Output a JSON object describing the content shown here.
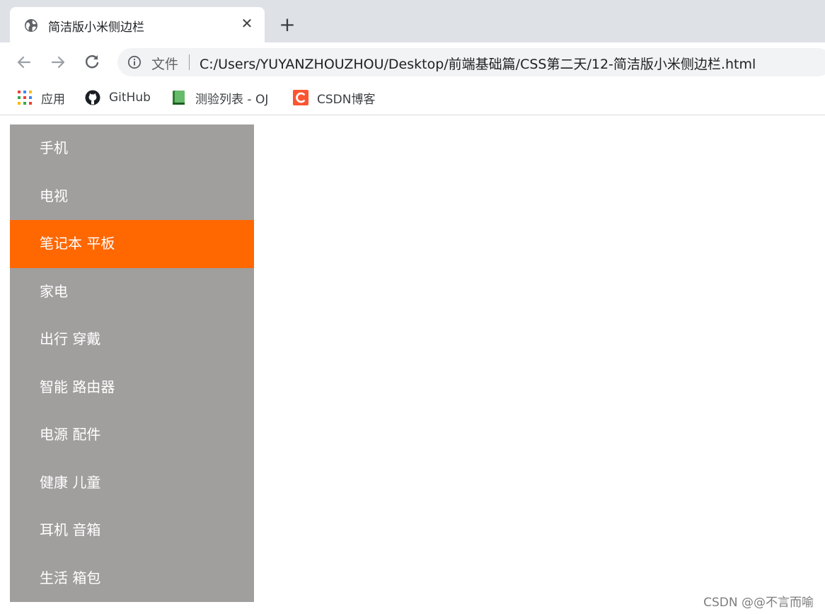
{
  "tab": {
    "title": "简洁版小米侧边栏",
    "close_glyph": "✕",
    "new_tab_glyph": "+"
  },
  "toolbar": {
    "scheme_label": "文件",
    "url": "C:/Users/YUYANZHOUZHOU/Desktop/前端基础篇/CSS第二天/12-简洁版小米侧边栏.html"
  },
  "bookmarks": [
    {
      "label": "应用",
      "icon": "apps-grid-icon"
    },
    {
      "label": "GitHub",
      "icon": "github-icon"
    },
    {
      "label": "测验列表 - OJ",
      "icon": "book-icon"
    },
    {
      "label": "CSDN博客",
      "icon": "csdn-icon"
    }
  ],
  "sidebar": {
    "items": [
      {
        "label": "手机"
      },
      {
        "label": "电视"
      },
      {
        "label": "笔记本 平板"
      },
      {
        "label": "家电"
      },
      {
        "label": "出行 穿戴"
      },
      {
        "label": "智能 路由器"
      },
      {
        "label": "电源 配件"
      },
      {
        "label": "健康 儿童"
      },
      {
        "label": "耳机 音箱"
      },
      {
        "label": "生活 箱包"
      }
    ],
    "active_index": 2,
    "colors": {
      "background": "#a19e9e",
      "active": "#ff6700",
      "text": "#ffffff"
    }
  },
  "watermark": "CSDN @@不言而喻"
}
